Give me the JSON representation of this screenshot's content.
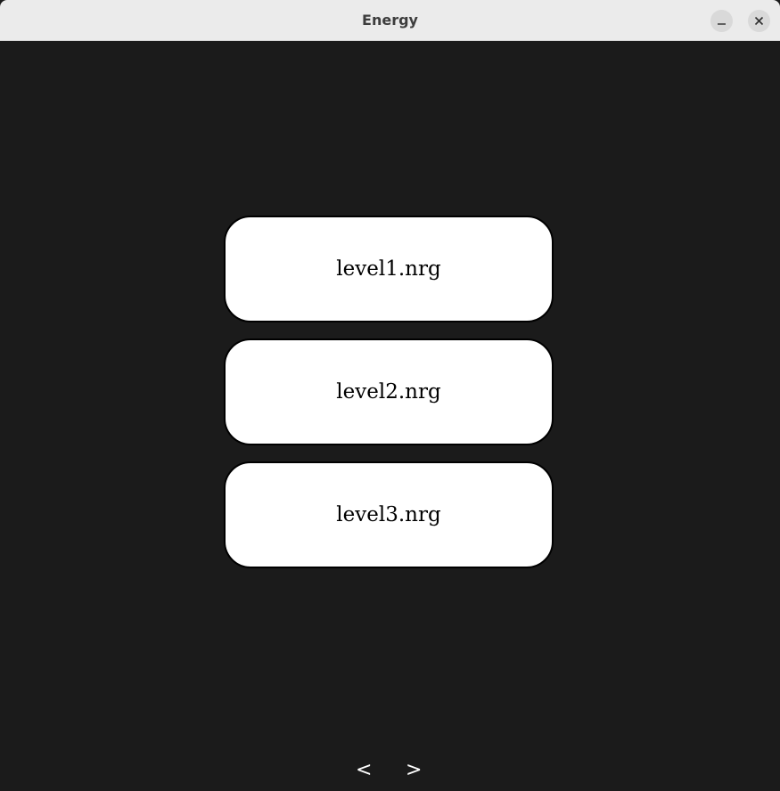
{
  "window": {
    "title": "Energy",
    "minimize_icon": "minimize-icon",
    "close_icon": "close-icon",
    "background_color": "#1b1b1b"
  },
  "levels": [
    {
      "label": "level1.nrg"
    },
    {
      "label": "level2.nrg"
    },
    {
      "label": "level3.nrg"
    }
  ],
  "pagination": {
    "prev_label": "<",
    "next_label": ">"
  }
}
